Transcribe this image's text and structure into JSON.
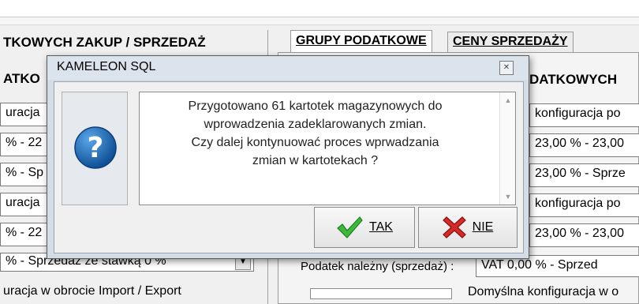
{
  "left": {
    "section_title": "TKOWYCH ZAKUP / SPRZEDAŻ",
    "sub_title": "ATKO",
    "rows": [
      "uracja",
      "% - 22",
      "% - Sp",
      "uracja",
      "% - 22",
      "% - Sprzedaż ze stawką 0 %",
      "uracja w obrocie Import / Export"
    ]
  },
  "right": {
    "tabs": [
      "GRUPY PODATKOWE",
      "CENY SPRZEDAŻY"
    ],
    "group_title": "DATKOWYCH",
    "rows": [
      "konfiguracja po",
      "23,00 % - 23,00",
      "23,00 % - Sprze",
      "konfiguracja po",
      "23,00 % - 23,00"
    ],
    "vat_label": "Podatek należny (sprzedaż) :",
    "vat_value": "VAT 0,00 % - Sprzed",
    "default_config": "Domyślna konfiguracja w o"
  },
  "dialog": {
    "title": "KAMELEON SQL",
    "close_icon": "close-icon",
    "icon": "question-icon",
    "message": "Przygotowano  61  kartotek magazynowych do\nwprowadzenia zadeklarowanych zmian.\nCzy dalej kontynuować proces wprwadzania\nzmian w kartotekach ?",
    "yes_label": "TAK",
    "no_label": "NIE"
  },
  "colors": {
    "icon_blue": "#1f6fb5",
    "check_green": "#3db83d",
    "cross_red": "#d52a2a"
  }
}
